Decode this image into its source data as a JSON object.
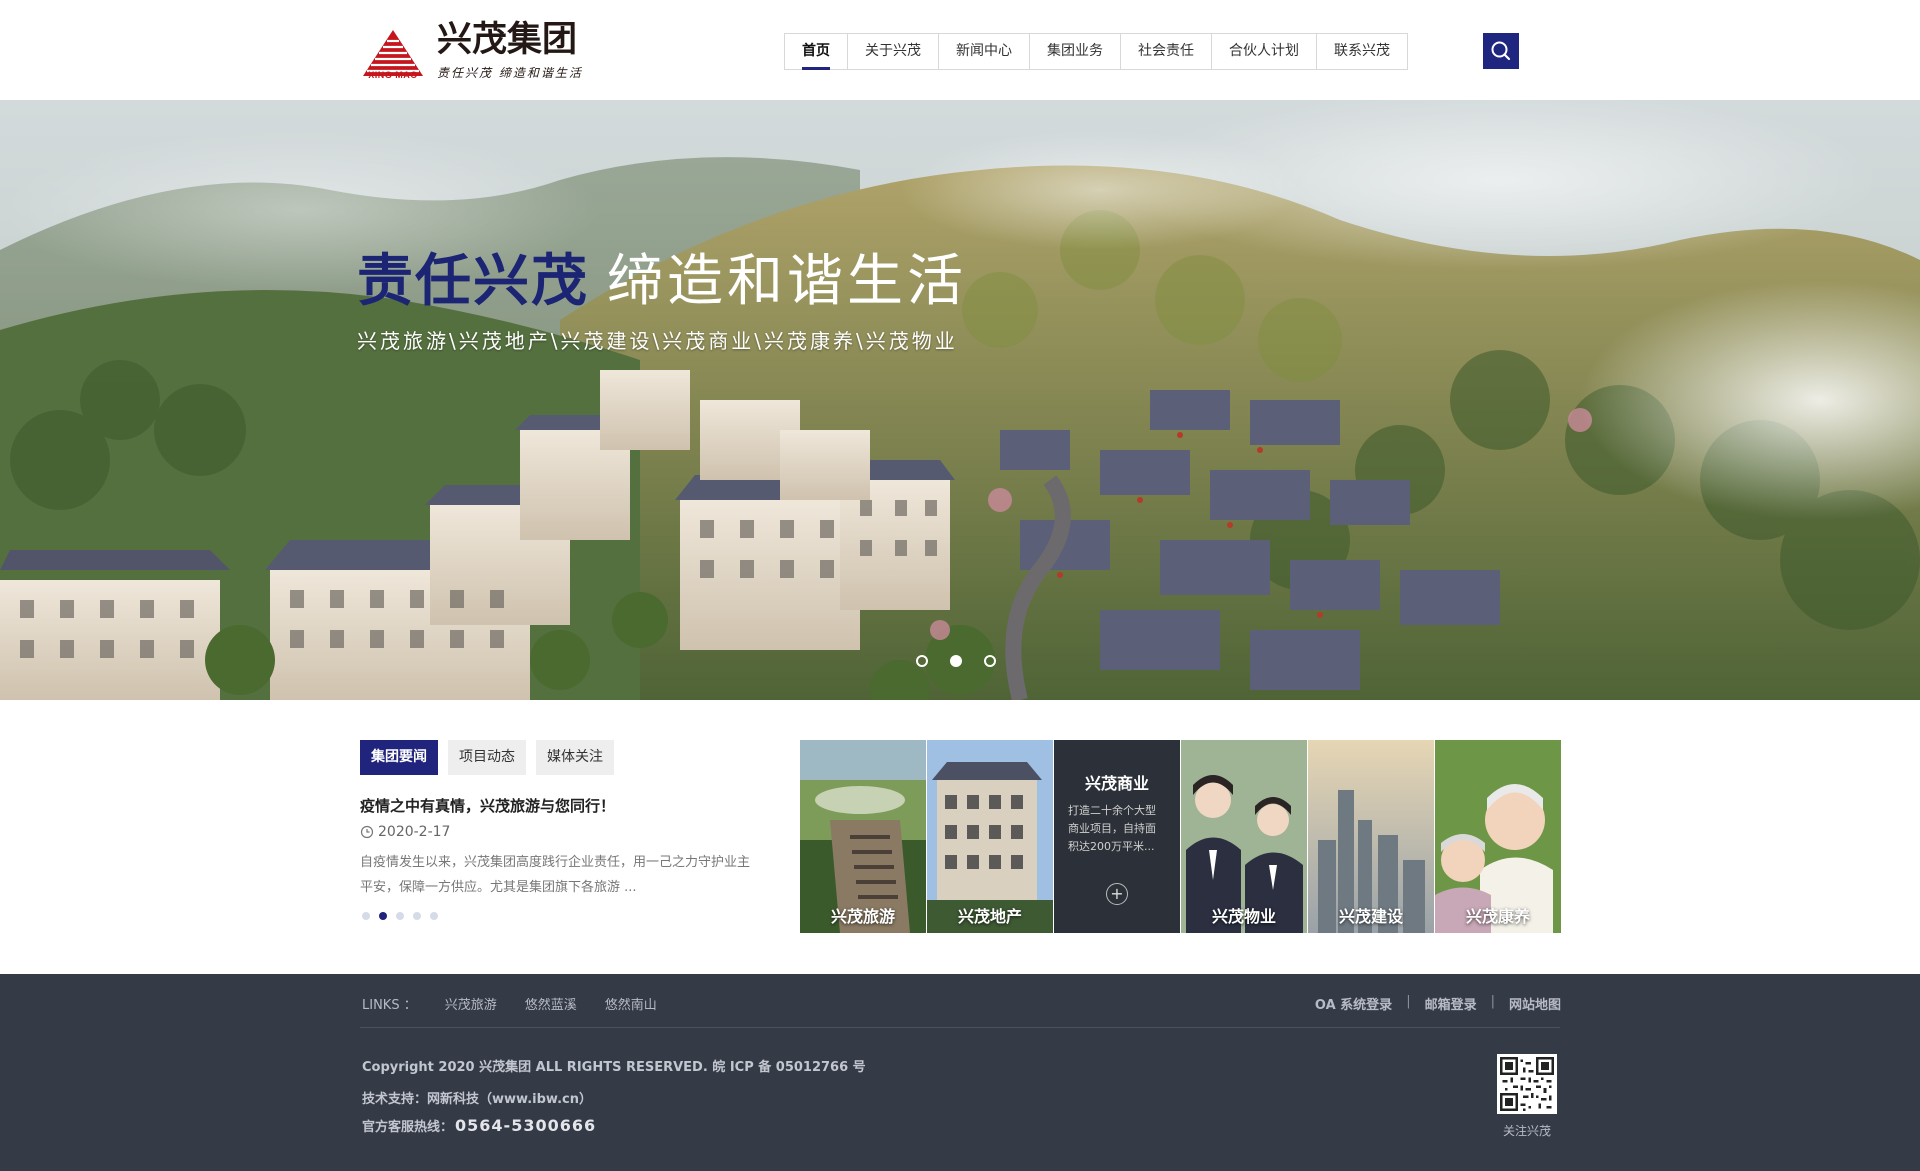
{
  "brand": {
    "name": "兴茂集团",
    "mark_text": "XING MAO",
    "slogan": "责任兴茂 缔造和谐生活",
    "primary_color": "#1f2680",
    "logo_red": "#c4161c"
  },
  "nav": {
    "items": [
      {
        "label": "首页",
        "active": true
      },
      {
        "label": "关于兴茂",
        "active": false
      },
      {
        "label": "新闻中心",
        "active": false
      },
      {
        "label": "集团业务",
        "active": false
      },
      {
        "label": "社会责任",
        "active": false
      },
      {
        "label": "合伙人计划",
        "active": false
      },
      {
        "label": "联系兴茂",
        "active": false
      }
    ],
    "search_icon": "search-icon"
  },
  "banner": {
    "title_strong": "责任兴茂",
    "title_light": "缔造和谐生活",
    "subtitle": "兴茂旅游\\兴茂地产\\兴茂建设\\兴茂商业\\兴茂康养\\兴茂物业",
    "slide_count": 3,
    "active_slide": 2
  },
  "news": {
    "tabs": [
      "集团要闻",
      "项目动态",
      "媒体关注"
    ],
    "active_tab": 0,
    "title": "疫情之中有真情，兴茂旅游与您同行！",
    "date": "2020-2-17",
    "summary": "自疫情发生以来，兴茂集团高度践行企业责任，用一己之力守护业主平安，保障一方供应。尤其是集团旗下各旅游 ...",
    "page_count": 5,
    "active_page": 2
  },
  "business": {
    "tiles": [
      {
        "label": "兴茂旅游",
        "scene": "tourism"
      },
      {
        "label": "兴茂地产",
        "scene": "realestate"
      },
      {
        "label": "兴茂商业",
        "scene": "commerce",
        "expanded": true,
        "desc": "打造二十余个大型商业项目，自持面积达200万平米..."
      },
      {
        "label": "兴茂物业",
        "scene": "property"
      },
      {
        "label": "兴茂建设",
        "scene": "construction"
      },
      {
        "label": "兴茂康养",
        "scene": "eldercare"
      }
    ]
  },
  "footer": {
    "links_label": "LINKS ：",
    "links": [
      "兴茂旅游",
      "悠然蓝溪",
      "悠然南山"
    ],
    "right_links": [
      "OA 系统登录",
      "邮箱登录",
      "网站地图"
    ],
    "copyright": "Copyright 2020 兴茂集团 ALL RIGHTS RESERVED. 皖 ICP 备 05012766 号",
    "tech_support": "技术支持：网新科技（www.ibw.cn）",
    "hotline_label": "官方客服热线：",
    "hotline_number": "0564-5300666",
    "qr_label": "关注兴茂",
    "background": "#353a47"
  }
}
